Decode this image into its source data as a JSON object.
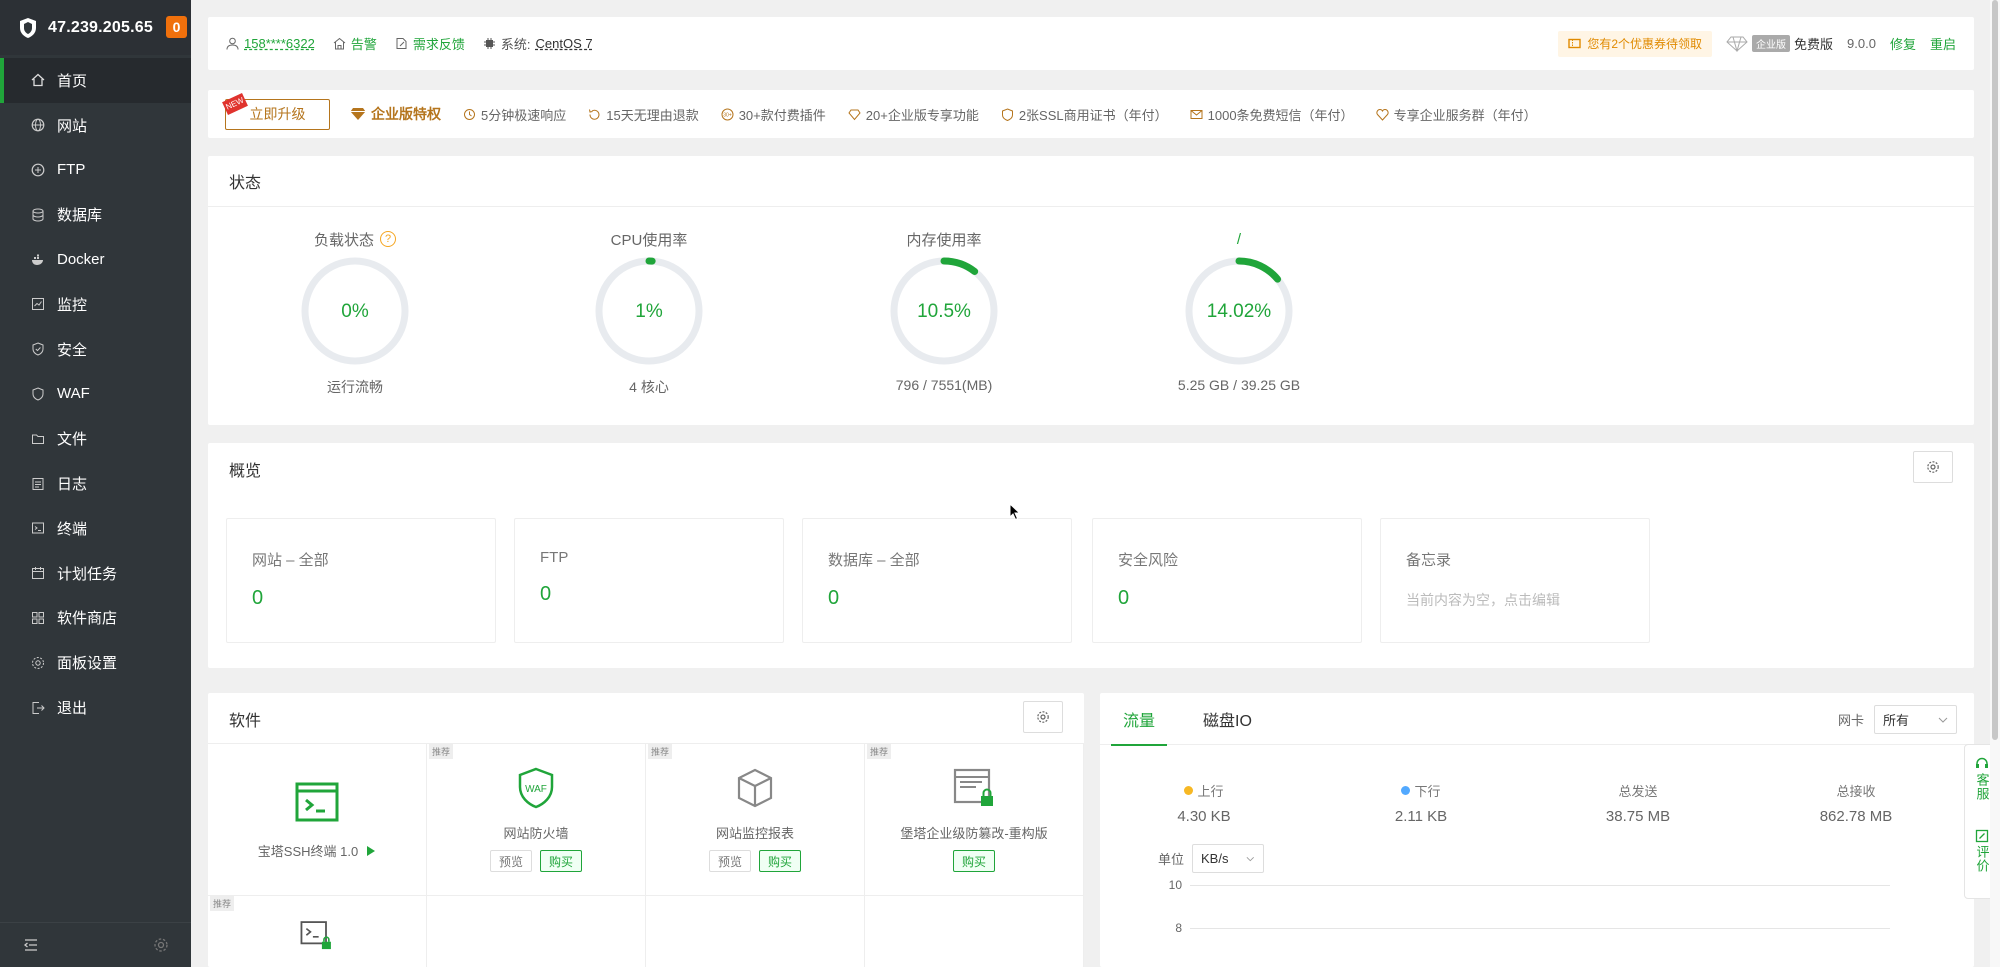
{
  "sidebar": {
    "ip": "47.239.205.65",
    "badge": "0",
    "items": [
      {
        "label": "首页",
        "icon": "home-icon",
        "active": true
      },
      {
        "label": "网站",
        "icon": "globe-icon"
      },
      {
        "label": "FTP",
        "icon": "ftp-icon"
      },
      {
        "label": "数据库",
        "icon": "database-icon"
      },
      {
        "label": "Docker",
        "icon": "docker-icon"
      },
      {
        "label": "监控",
        "icon": "monitor-icon"
      },
      {
        "label": "安全",
        "icon": "shield-icon"
      },
      {
        "label": "WAF",
        "icon": "waf-icon"
      },
      {
        "label": "文件",
        "icon": "folder-icon"
      },
      {
        "label": "日志",
        "icon": "log-icon"
      },
      {
        "label": "终端",
        "icon": "terminal-icon"
      },
      {
        "label": "计划任务",
        "icon": "calendar-icon"
      },
      {
        "label": "软件商店",
        "icon": "apps-icon"
      },
      {
        "label": "面板设置",
        "icon": "settings-icon"
      },
      {
        "label": "退出",
        "icon": "logout-icon"
      }
    ]
  },
  "topbar": {
    "user": "158****6322",
    "alert": "告警",
    "feedback": "需求反馈",
    "system_label": "系统:",
    "system_value": "CentOS 7",
    "coupon": "您有2个优惠券待领取",
    "ent_tag": "企业版",
    "free_label": "免费版",
    "version": "9.0.0",
    "repair": "修复",
    "restart": "重启"
  },
  "upgrade": {
    "new_tag": "NEW",
    "button": "立即升级",
    "enterprise": "企业版特权",
    "features": [
      {
        "label": "5分钟极速响应",
        "icon": "speed-icon"
      },
      {
        "label": "15天无理由退款",
        "icon": "refund-icon"
      },
      {
        "label": "30+款付费插件",
        "icon": "plugin-icon"
      },
      {
        "label": "20+企业版专享功能",
        "icon": "diamond-icon"
      },
      {
        "label": "2张SSL商用证书（年付）",
        "icon": "ssl-icon"
      },
      {
        "label": "1000条免费短信（年付）",
        "icon": "mail-icon"
      },
      {
        "label": "专享企业服务群（年付）",
        "icon": "service-icon"
      }
    ]
  },
  "status": {
    "title": "状态",
    "gauges": [
      {
        "label": "负载状态",
        "value": "0%",
        "percent": 0,
        "sub": "运行流畅",
        "help": "?"
      },
      {
        "label": "CPU使用率",
        "value": "1%",
        "percent": 1,
        "sub": "4 核心"
      },
      {
        "label": "内存使用率",
        "value": "10.5%",
        "percent": 10.5,
        "sub": "796 / 7551(MB)"
      },
      {
        "label": "/",
        "value": "14.02%",
        "percent": 14.02,
        "sub": "5.25 GB / 39.25 GB"
      }
    ]
  },
  "overview": {
    "title": "概览",
    "cards": [
      {
        "title": "网站 – 全部",
        "value": "0"
      },
      {
        "title": "FTP",
        "value": "0"
      },
      {
        "title": "数据库 – 全部",
        "value": "0"
      },
      {
        "title": "安全风险",
        "value": "0"
      },
      {
        "title": "备忘录",
        "memo": "当前内容为空，点击编辑"
      }
    ]
  },
  "software": {
    "title": "软件",
    "items": [
      {
        "name": "宝塔SSH终端 1.0",
        "tag": ""
      },
      {
        "name": "网站防火墙",
        "tag": "推荐",
        "preview": "预览",
        "buy": "购买"
      },
      {
        "name": "网站监控报表",
        "tag": "推荐",
        "preview": "预览",
        "buy": "购买"
      },
      {
        "name": "堡塔企业级防篡改-重构版",
        "tag": "推荐",
        "buy": "购买"
      },
      {
        "name": "",
        "tag": "推荐"
      }
    ],
    "waf_text": "WAF"
  },
  "traffic": {
    "tabs": [
      "流量",
      "磁盘IO"
    ],
    "nic_label": "网卡",
    "nic_value": "所有",
    "stats": [
      {
        "label": "上行",
        "value": "4.30 KB",
        "color": "#f7b824"
      },
      {
        "label": "下行",
        "value": "2.11 KB",
        "color": "#52a9ff"
      },
      {
        "label": "总发送",
        "value": "38.75 MB"
      },
      {
        "label": "总接收",
        "value": "862.78 MB"
      }
    ],
    "unit_label": "单位",
    "unit_value": "KB/s",
    "y_ticks": [
      "10",
      "8"
    ]
  },
  "float": {
    "service": "客服",
    "review": "评价"
  },
  "colors": {
    "accent": "#20a53a",
    "sidebar_bg": "#30363a",
    "gold": "#b5751d",
    "badge": "#f0700c"
  }
}
